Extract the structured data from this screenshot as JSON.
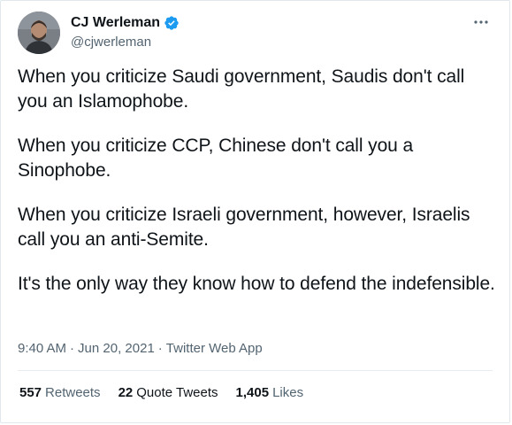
{
  "author": {
    "name": "CJ Werleman",
    "handle": "@cjwerleman",
    "verified": true,
    "avatar_icon": "profile-photo"
  },
  "tweet": {
    "paragraphs": [
      "When you criticize Saudi government, Saudis don't call you an Islamophobe.",
      "When you criticize CCP, Chinese don't call you a Sinophobe.",
      "When you criticize Israeli government, however, Israelis call you an anti-Semite.",
      "It's the only way they know how to defend the indefensible."
    ]
  },
  "meta": {
    "time": "9:40 AM",
    "sep1": "·",
    "date": "Jun 20, 2021",
    "sep2": "·",
    "source": "Twitter Web App"
  },
  "stats": {
    "retweets_count": "557",
    "retweets_label": "Retweets",
    "quotes_count": "22",
    "quotes_label": "Quote Tweets",
    "likes_count": "1,405",
    "likes_label": "Likes"
  },
  "colors": {
    "verified_blue": "#1d9bf0",
    "secondary_text": "#536471",
    "primary_text": "#0f1419"
  },
  "icons": {
    "more": "more-horizontal-icon",
    "verified": "verified-badge-icon"
  }
}
